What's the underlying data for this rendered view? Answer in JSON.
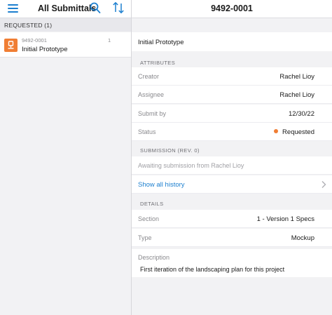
{
  "left": {
    "title": "All Submittals",
    "group_header": "REQUESTED (1)",
    "items": [
      {
        "number": "9492-0001",
        "title": "Initial Prototype",
        "count": "1"
      }
    ]
  },
  "right": {
    "title": "9492-0001",
    "submittal_title": "Initial Prototype",
    "attributes": {
      "header": "ATTRIBUTES",
      "creator_label": "Creator",
      "creator_value": "Rachel Lioy",
      "assignee_label": "Assignee",
      "assignee_value": "Rachel Lioy",
      "submit_by_label": "Submit by",
      "submit_by_value": "12/30/22",
      "status_label": "Status",
      "status_value": "Requested"
    },
    "submission": {
      "header": "SUBMISSION (REV. 0)",
      "awaiting_text": "Awaiting submission from Rachel Lioy",
      "history_link": "Show all history"
    },
    "details": {
      "header": "DETAILS",
      "section_label": "Section",
      "section_value": "1 - Version 1 Specs",
      "type_label": "Type",
      "type_value": "Mockup",
      "description_label": "Description",
      "description_value": "First iteration of the landscaping plan for this project"
    }
  },
  "colors": {
    "accent": "#1c7fcf",
    "status_requested": "#f07e34"
  },
  "icons": [
    "hamburger-menu-icon",
    "search-icon",
    "sort-icon",
    "submittal-icon",
    "chevron-right-icon"
  ]
}
